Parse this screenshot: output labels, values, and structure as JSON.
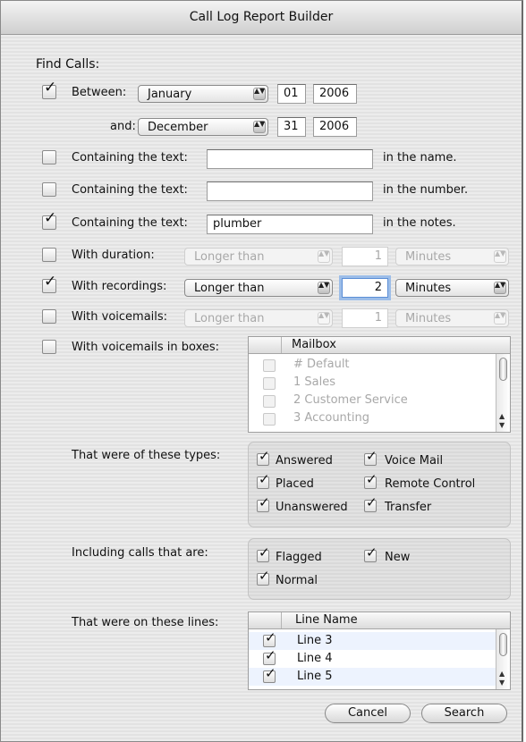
{
  "window": {
    "title": "Call Log Report Builder"
  },
  "find_calls_label": "Find Calls:",
  "between": {
    "checked": true,
    "label": "Between:",
    "month": "January",
    "day": "01",
    "year": "2006"
  },
  "and": {
    "label": "and:",
    "month": "December",
    "day": "31",
    "year": "2006"
  },
  "text_filters": [
    {
      "checked": false,
      "label": "Containing the text:",
      "value": "",
      "suffix": "in the name."
    },
    {
      "checked": false,
      "label": "Containing the text:",
      "value": "",
      "suffix": "in the number."
    },
    {
      "checked": true,
      "label": "Containing the text:",
      "value": "plumber",
      "suffix": "in the notes."
    }
  ],
  "duration": {
    "checked": false,
    "label": "With duration:",
    "comparator": "Longer than",
    "amount": "1",
    "unit": "Minutes"
  },
  "recordings": {
    "checked": true,
    "label": "With recordings:",
    "comparator": "Longer than",
    "amount": "2",
    "unit": "Minutes"
  },
  "voicemails": {
    "checked": false,
    "label": "With voicemails:",
    "comparator": "Longer than",
    "amount": "1",
    "unit": "Minutes"
  },
  "voicemail_boxes": {
    "checked": false,
    "label": "With voicemails in boxes:",
    "column": "Mailbox",
    "rows": [
      {
        "checked": false,
        "name": "# Default"
      },
      {
        "checked": false,
        "name": "1 Sales"
      },
      {
        "checked": false,
        "name": "2 Customer Service"
      },
      {
        "checked": false,
        "name": "3 Accounting"
      }
    ]
  },
  "types": {
    "label": "That were of these types:",
    "items": [
      {
        "checked": true,
        "label": "Answered"
      },
      {
        "checked": true,
        "label": "Voice Mail"
      },
      {
        "checked": true,
        "label": "Placed"
      },
      {
        "checked": true,
        "label": "Remote Control"
      },
      {
        "checked": true,
        "label": "Unanswered"
      },
      {
        "checked": true,
        "label": "Transfer"
      }
    ]
  },
  "including": {
    "label": "Including calls that are:",
    "items": [
      {
        "checked": true,
        "label": "Flagged"
      },
      {
        "checked": true,
        "label": "New"
      },
      {
        "checked": true,
        "label": "Normal"
      }
    ]
  },
  "lines": {
    "label": "That were on these lines:",
    "column": "Line Name",
    "rows": [
      {
        "checked": true,
        "name": "Line 3"
      },
      {
        "checked": true,
        "name": "Line 4"
      },
      {
        "checked": true,
        "name": "Line 5"
      }
    ]
  },
  "buttons": {
    "cancel": "Cancel",
    "search": "Search"
  },
  "glyphs": {
    "check": "✓",
    "popup_arrows": "▲▼",
    "scroll_up": "▲",
    "scroll_down": "▼"
  }
}
